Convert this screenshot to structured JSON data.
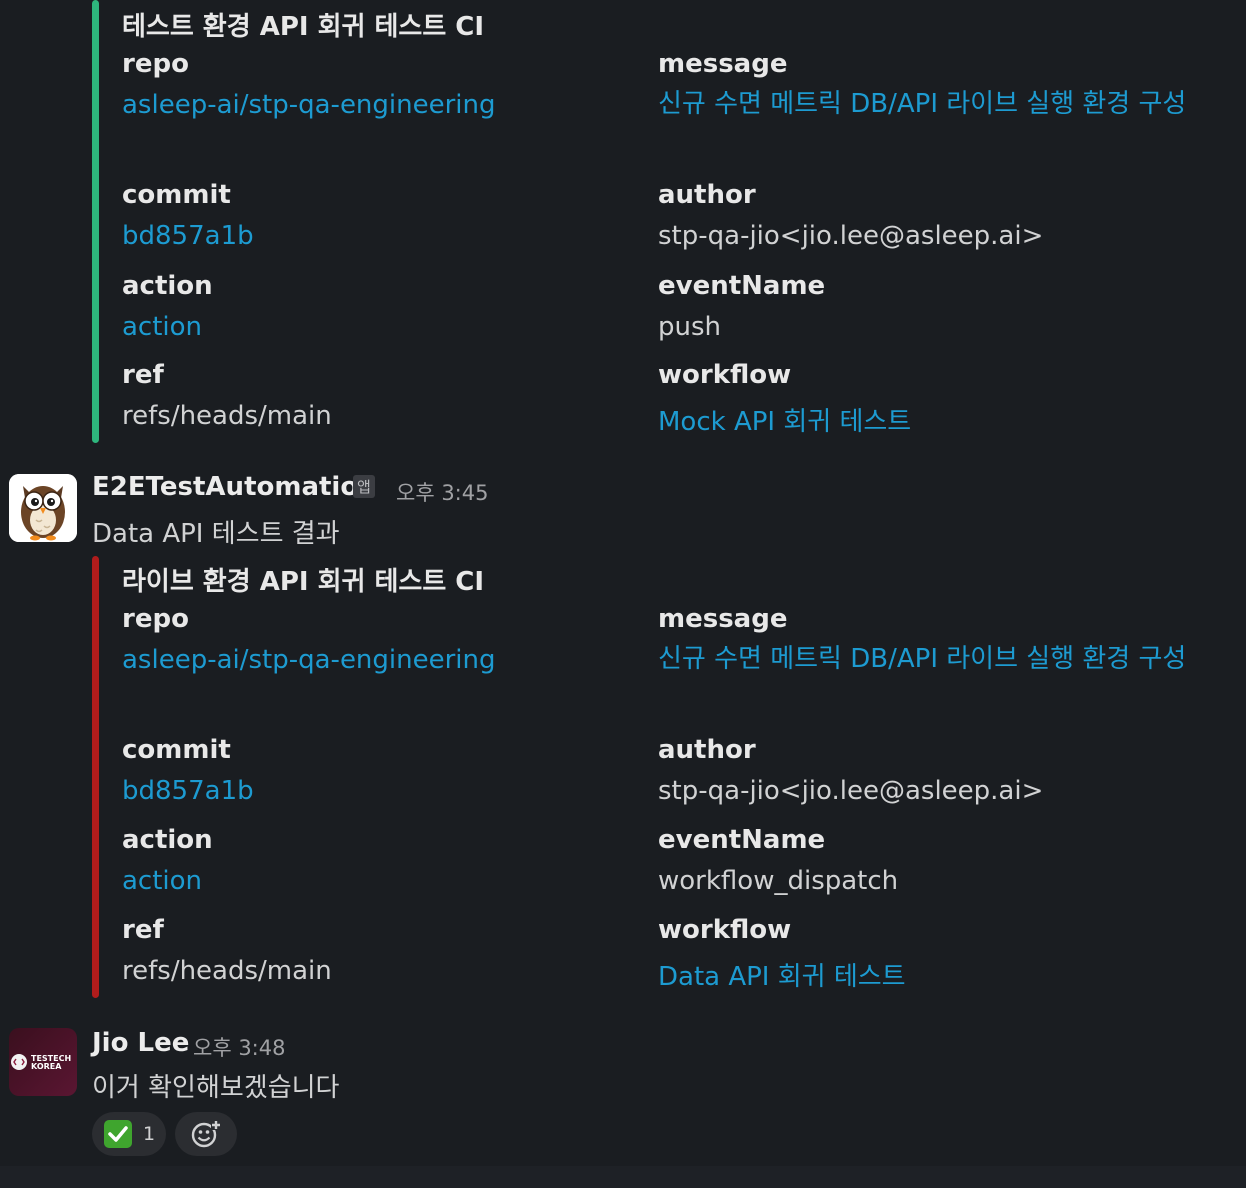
{
  "colors": {
    "background": "#1a1d21",
    "link": "#1d9bd1",
    "success_bar": "#2eb67d",
    "failure_bar": "#b01c1c"
  },
  "attachment1": {
    "title": "테스트 환경 API 회귀 테스트 CI",
    "repo_label": "repo",
    "repo_value": "asleep-ai/stp-qa-engineering",
    "message_label": "message",
    "message_value": "신규 수면 메트릭 DB/API 라이브 실행 환경 구성",
    "commit_label": "commit",
    "commit_value": "bd857a1b",
    "author_label": "author",
    "author_value": "stp-qa-jio<jio.lee@asleep.ai>",
    "action_label": "action",
    "action_value": "action",
    "event_label": "eventName",
    "event_value": "push",
    "ref_label": "ref",
    "ref_value": "refs/heads/main",
    "workflow_label": "workflow",
    "workflow_value": "Mock API 회귀 테스트"
  },
  "message2": {
    "avatar_icon": "owl-icon",
    "sender": "E2ETestAutomation",
    "badge": "앱",
    "time": "오후 3:45",
    "text": "Data API 테스트 결과"
  },
  "attachment2": {
    "title": "라이브 환경 API 회귀 테스트 CI",
    "repo_label": "repo",
    "repo_value": "asleep-ai/stp-qa-engineering",
    "message_label": "message",
    "message_value": "신규 수면 메트릭 DB/API 라이브 실행 환경 구성",
    "commit_label": "commit",
    "commit_value": "bd857a1b",
    "author_label": "author",
    "author_value": "stp-qa-jio<jio.lee@asleep.ai>",
    "action_label": "action",
    "action_value": "action",
    "event_label": "eventName",
    "event_value": "workflow_dispatch",
    "ref_label": "ref",
    "ref_value": "refs/heads/main",
    "workflow_label": "workflow",
    "workflow_value": "Data API 회귀 테스트"
  },
  "message3": {
    "avatar_logo_text_1": "TESTECH",
    "avatar_logo_text_2": "KOREA",
    "sender": "Jio Lee",
    "time": "오후 3:48",
    "text": "이거 확인해보겠습니다",
    "reaction_icon": "check-mark-icon",
    "reaction_count": "1",
    "add_reaction_icon": "add-reaction-icon"
  }
}
